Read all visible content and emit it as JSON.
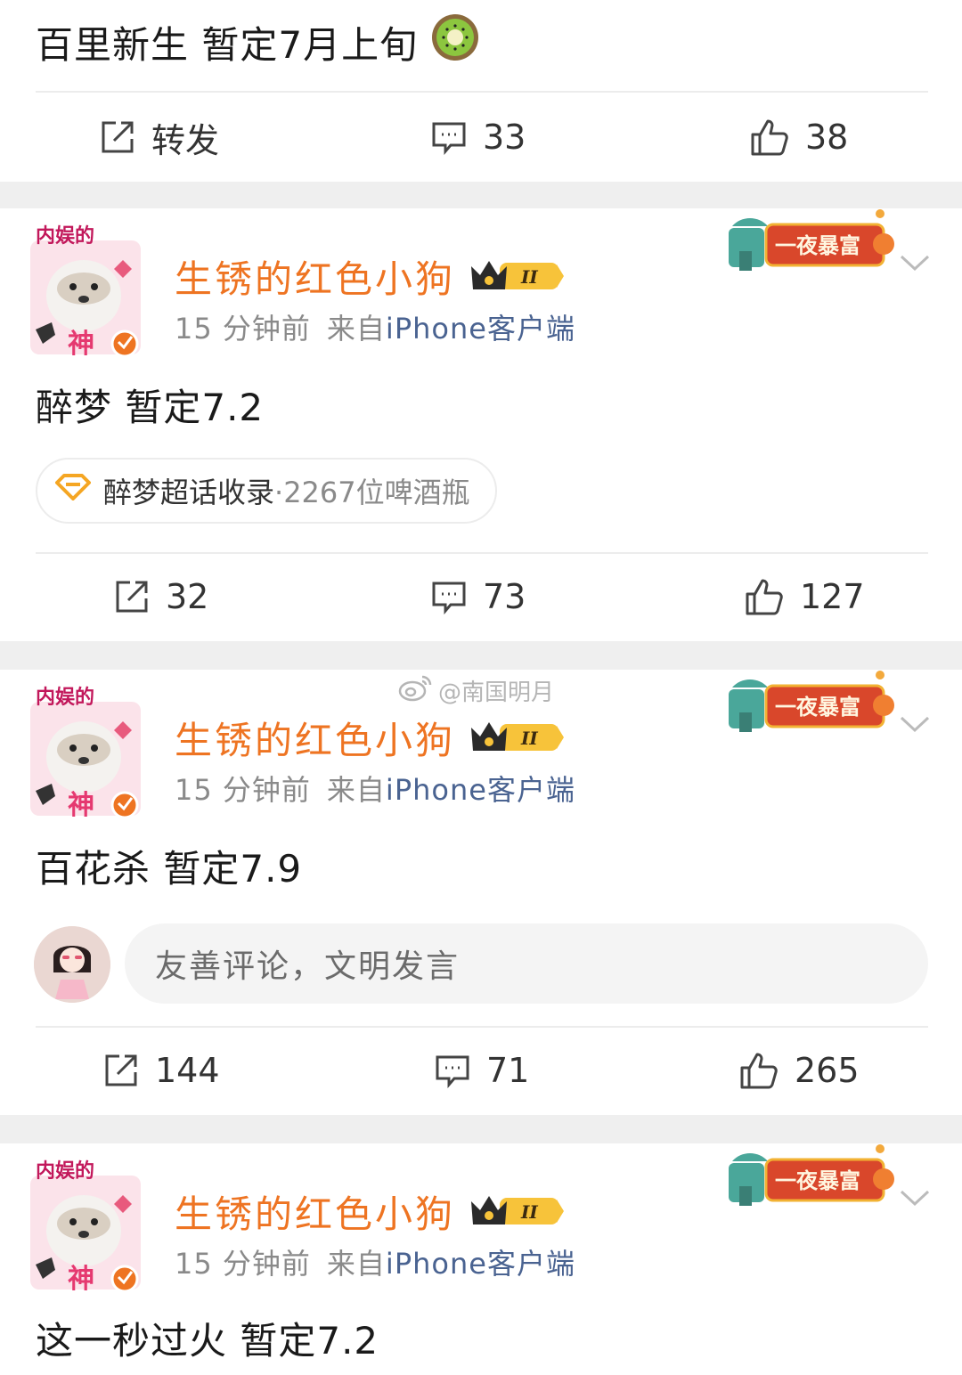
{
  "posts": [
    {
      "text": "百里新生 暂定7月上旬",
      "emoji_icon": "kiwi-fruit-icon",
      "actions": {
        "repost": "转发",
        "comments": "33",
        "likes": "38"
      }
    },
    {
      "author": "生锈的红色小狗",
      "level": "II",
      "time": "15 分钟前",
      "source_prefix": "来自",
      "source": "iPhone客户端",
      "badge": "一夜暴富",
      "avatar_caption_top": "内娱的",
      "avatar_caption_bottom": "神",
      "text": "醉梦 暂定7.2",
      "topic": {
        "name": "醉梦超话收录",
        "sep": "·",
        "count": "2267位啤酒瓶"
      },
      "actions": {
        "repost": "32",
        "comments": "73",
        "likes": "127"
      }
    },
    {
      "author": "生锈的红色小狗",
      "level": "II",
      "time": "15 分钟前",
      "source_prefix": "来自",
      "source": "iPhone客户端",
      "badge": "一夜暴富",
      "avatar_caption_top": "内娱的",
      "avatar_caption_bottom": "神",
      "text": "百花杀 暂定7.9",
      "comment_placeholder": "友善评论，文明发言",
      "actions": {
        "repost": "144",
        "comments": "71",
        "likes": "265"
      }
    },
    {
      "author": "生锈的红色小狗",
      "level": "II",
      "time": "15 分钟前",
      "source_prefix": "来自",
      "source": "iPhone客户端",
      "badge": "一夜暴富",
      "avatar_caption_top": "内娱的",
      "avatar_caption_bottom": "神",
      "text": "这一秒过火 暂定7.2"
    }
  ],
  "watermark": "@南国明月",
  "colors": {
    "author": "#ee7422",
    "source_link": "#4a6391",
    "badge_red": "#d9472b",
    "badge_teal": "#4aa79a",
    "background": "#efefef"
  }
}
